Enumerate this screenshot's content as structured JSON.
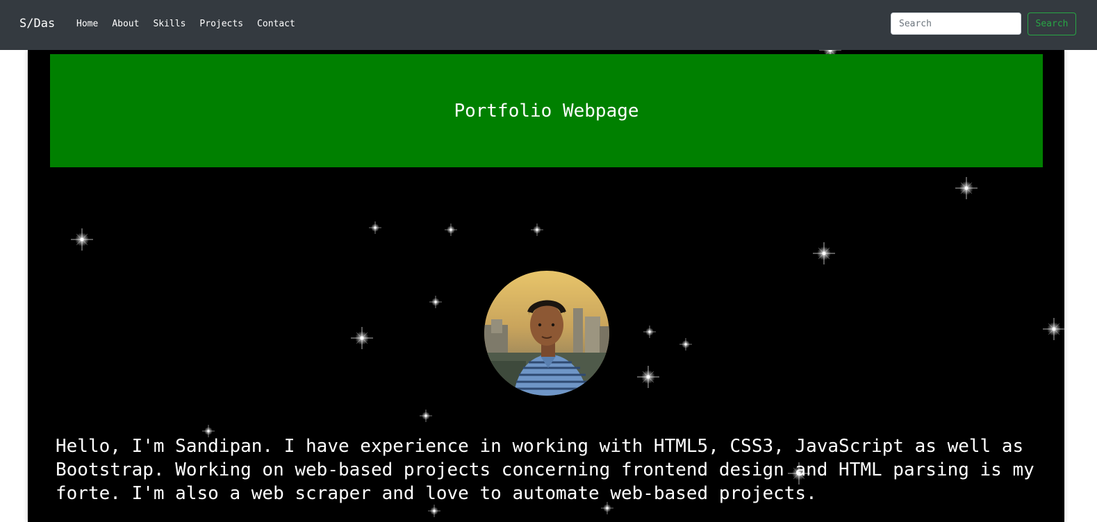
{
  "navbar": {
    "brand": "S/Das",
    "links": [
      {
        "label": "Home"
      },
      {
        "label": "About"
      },
      {
        "label": "Skills"
      },
      {
        "label": "Projects"
      },
      {
        "label": "Contact"
      }
    ],
    "search": {
      "placeholder": "Search",
      "value": "",
      "button_label": "Search"
    }
  },
  "banner": {
    "title": "Portfolio Webpage"
  },
  "intro": {
    "text": "Hello, I'm Sandipan. I have experience in working with HTML5, CSS3, JavaScript as well as Bootstrap. Working on web-based projects concerning frontend design and HTML parsing is my forte. I'm also a web scraper and love to automate web-based projects."
  },
  "colors": {
    "navbar_bg": "#343a40",
    "banner_bg": "#008000",
    "page_bg": "#000000",
    "search_button": "#28a745"
  }
}
